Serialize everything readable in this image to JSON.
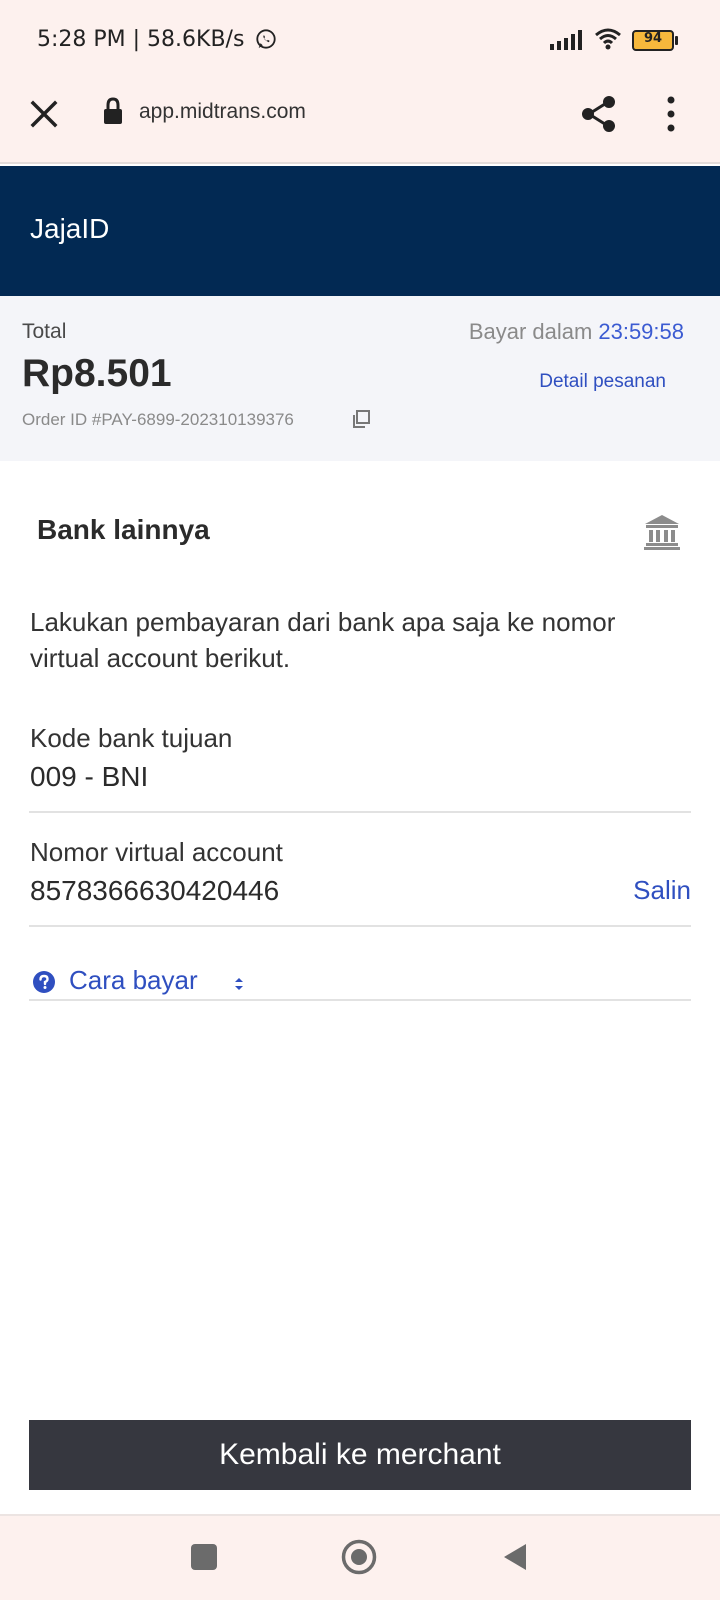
{
  "status_bar": {
    "time_speed": "5:28 PM | 58.6KB/s",
    "battery": "94"
  },
  "browser": {
    "url": "app.midtrans.com"
  },
  "merchant": {
    "name": "JajaID"
  },
  "summary": {
    "total_label": "Total",
    "amount": "Rp8.501",
    "order_id": "Order ID #PAY-6899-202310139376",
    "pay_within_label": "Bayar dalam",
    "countdown": "23:59:58",
    "detail_link": "Detail pesanan"
  },
  "payment": {
    "method_title": "Bank lainnya",
    "instruction": "Lakukan pembayaran dari bank apa saja ke nomor virtual account berikut.",
    "bank_code_label": "Kode bank tujuan",
    "bank_code_value": "009 - BNI",
    "va_label": "Nomor virtual account",
    "va_value": "8578366630420446",
    "copy_label": "Salin",
    "how_to_pay": "Cara bayar"
  },
  "actions": {
    "back_to_merchant": "Kembali ke merchant"
  },
  "icons": {
    "status": [
      "whatsapp-icon",
      "signal-icon",
      "wifi-icon",
      "battery-icon"
    ],
    "browser": [
      "close-icon",
      "lock-icon",
      "share-icon",
      "more-vert-icon"
    ],
    "content": [
      "copy-icon",
      "bank-icon",
      "help-icon",
      "sort-icon"
    ],
    "nav": [
      "recents-icon",
      "home-icon",
      "back-icon"
    ]
  },
  "colors": {
    "header_bg": "#022953",
    "accent_blue": "#2f4fc0",
    "button_bg": "#36373f",
    "system_bar_bg": "#fdf1ee",
    "summary_bg": "#f4f5f9"
  }
}
